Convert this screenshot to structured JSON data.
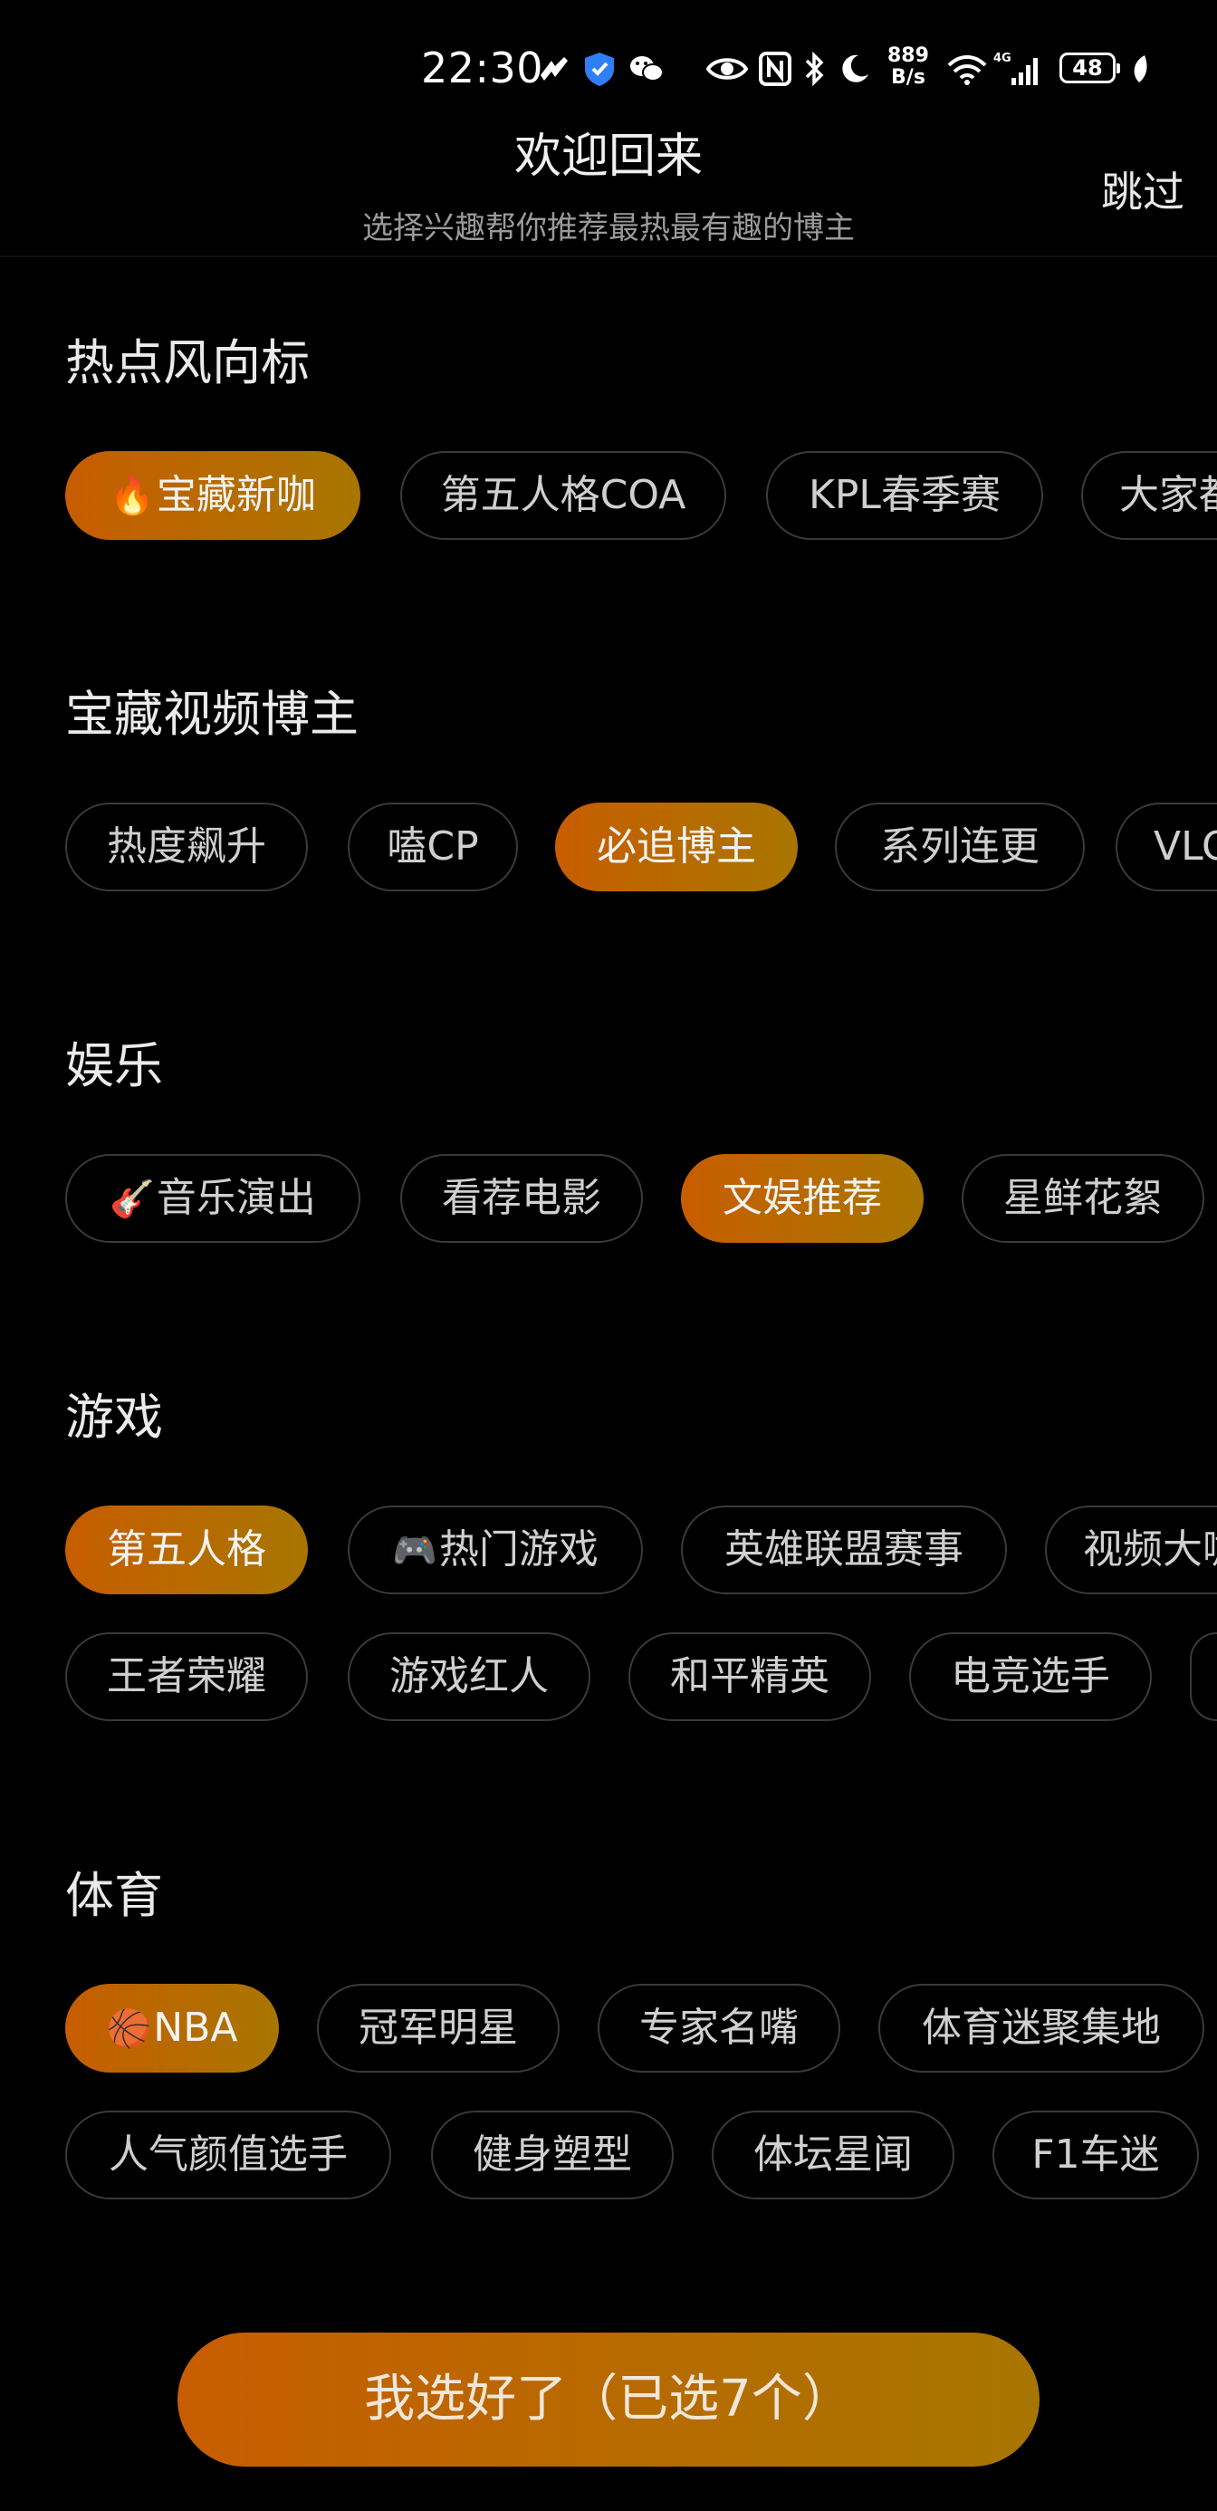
{
  "status_bar": {
    "time": "22:30",
    "net_speed_value": "889",
    "net_speed_unit": "B/s",
    "signal_label": "4G",
    "wifi_label": "6",
    "battery": "48"
  },
  "header": {
    "title": "欢迎回来",
    "subtitle": "选择兴趣帮你推荐最热最有趣的博主",
    "skip_label": "跳过"
  },
  "sections": [
    {
      "title": "热点风向标",
      "chips": [
        {
          "label": "宝藏新咖",
          "emoji": "🔥",
          "selected": true
        },
        {
          "label": "第五人格COA",
          "selected": false
        },
        {
          "label": "KPL春季赛",
          "selected": false
        },
        {
          "label": "大家都",
          "selected": false
        }
      ]
    },
    {
      "title": "宝藏视频博主",
      "chips": [
        {
          "label": "热度飙升",
          "selected": false
        },
        {
          "label": "嗑CP",
          "selected": false
        },
        {
          "label": "必追博主",
          "selected": true
        },
        {
          "label": "系列连更",
          "selected": false
        },
        {
          "label": "VLOG",
          "selected": false
        }
      ]
    },
    {
      "title": "娱乐",
      "chips": [
        {
          "label": "音乐演出",
          "emoji": "🎸",
          "selected": false
        },
        {
          "label": "看荐电影",
          "selected": false
        },
        {
          "label": "文娱推荐",
          "selected": true
        },
        {
          "label": "星鲜花絮",
          "selected": false
        }
      ]
    },
    {
      "title": "游戏",
      "chips": [
        {
          "label": "第五人格",
          "selected": true
        },
        {
          "label": "热门游戏",
          "emoji": "🎮",
          "selected": false
        },
        {
          "label": "英雄联盟赛事",
          "selected": false
        },
        {
          "label": "视频大咖",
          "selected": false
        }
      ],
      "chips_row2": [
        {
          "label": "王者荣耀",
          "selected": false
        },
        {
          "label": "游戏红人",
          "selected": false
        },
        {
          "label": "和平精英",
          "selected": false
        },
        {
          "label": "电竞选手",
          "selected": false
        },
        {
          "label": "",
          "selected": false
        }
      ]
    },
    {
      "title": "体育",
      "chips": [
        {
          "label": "NBA",
          "emoji": "🏀",
          "selected": true
        },
        {
          "label": "冠军明星",
          "selected": false
        },
        {
          "label": "专家名嘴",
          "selected": false
        },
        {
          "label": "体育迷聚集地",
          "selected": false
        }
      ],
      "chips_row2": [
        {
          "label": "人气颜值选手",
          "selected": false
        },
        {
          "label": "健身塑型",
          "selected": false
        },
        {
          "label": "体坛星闻",
          "selected": false
        },
        {
          "label": "F1车迷",
          "selected": false
        }
      ]
    }
  ],
  "confirm_button": {
    "label": "我选好了（已选7个）"
  },
  "colors": {
    "accent_start": "#c75d00",
    "accent_end": "#a87600",
    "background": "#000000"
  }
}
